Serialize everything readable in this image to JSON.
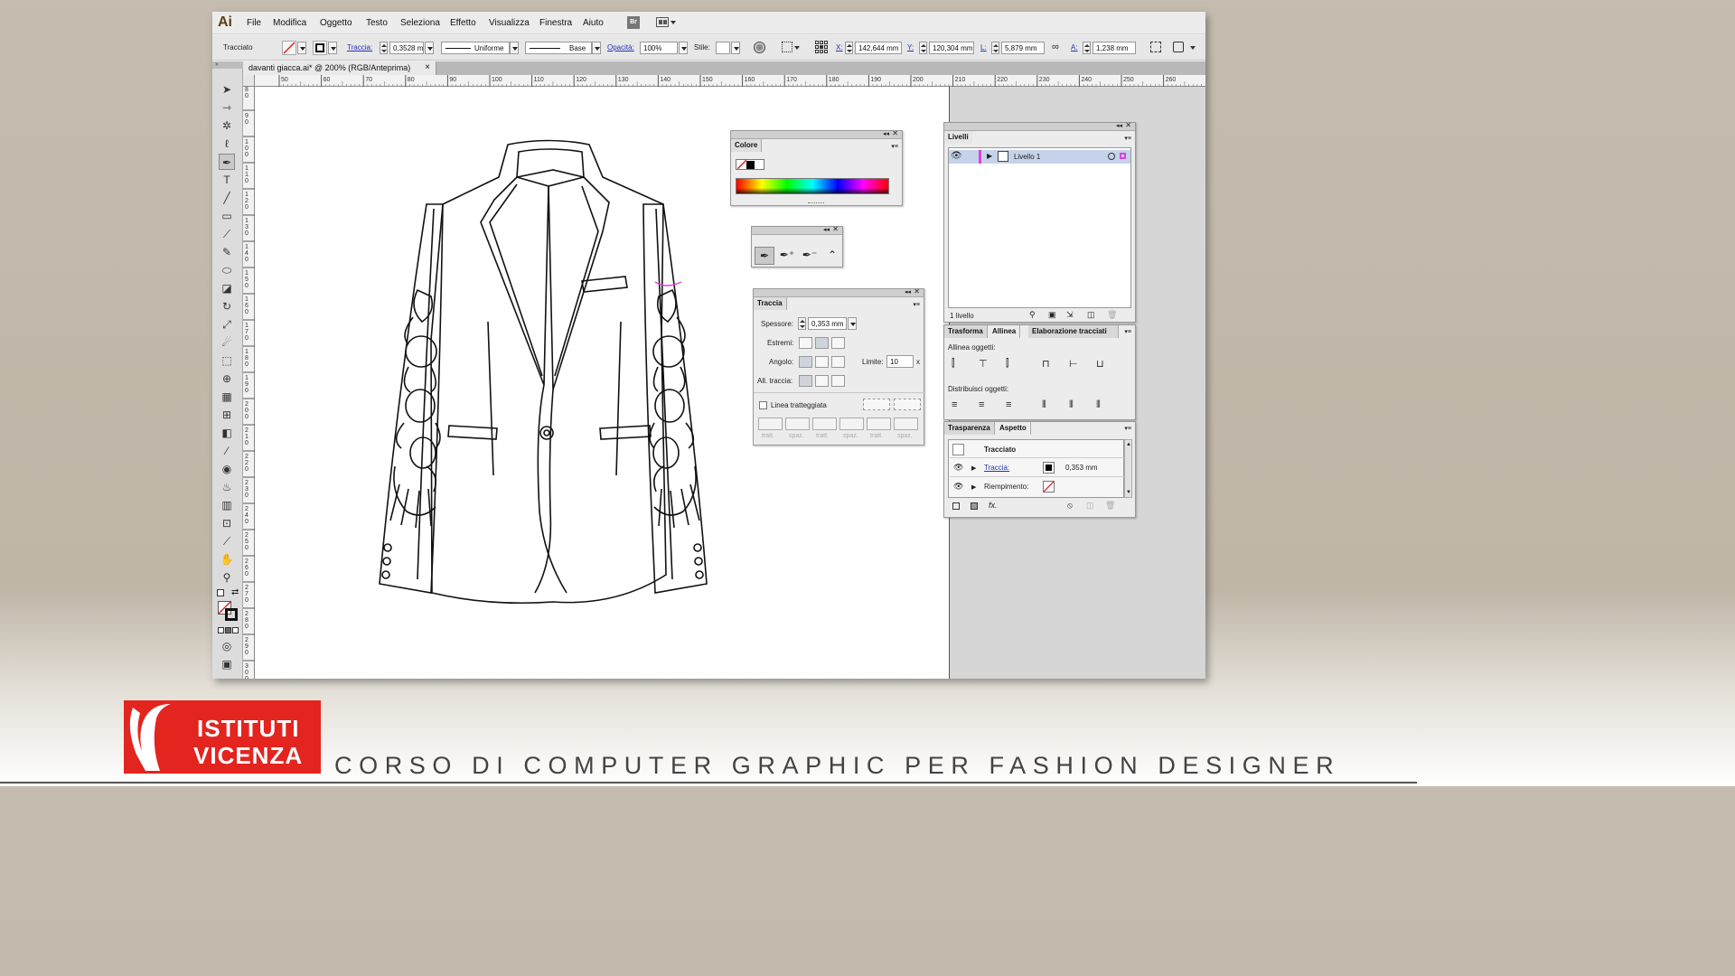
{
  "app": {
    "logo": "Ai"
  },
  "menu": [
    "File",
    "Modifica",
    "Oggetto",
    "Testo",
    "Seleziona",
    "Effetto",
    "Visualizza",
    "Finestra",
    "Aiuto"
  ],
  "menu_br": "Br",
  "control_bar": {
    "object_type": "Tracciato",
    "stroke_label": "Traccia:",
    "stroke_value": "0,3528 m",
    "profile_value": "Uniforme",
    "brush_value": "Base",
    "opacity_label": "Opacità:",
    "opacity_value": "100%",
    "style_label": "Stile:",
    "x_label": "X:",
    "x_value": "142,644 mm",
    "y_label": "Y:",
    "y_value": "120,304 mm",
    "w_label": "L:",
    "w_value": "5,879 mm",
    "h_label": "A:",
    "h_value": "1,238 mm"
  },
  "document_tab": {
    "title": "davanti giacca.ai* @ 200% (RGB/Anteprima)",
    "close": "×"
  },
  "rulers": {
    "h_ticks": [
      "50",
      "60",
      "70",
      "80",
      "90",
      "100",
      "110",
      "120",
      "130",
      "140",
      "150",
      "160",
      "170",
      "180",
      "190",
      "200",
      "210",
      "220",
      "230",
      "240",
      "250",
      "260"
    ],
    "v_ticks": [
      "80",
      "90",
      "100",
      "110",
      "120",
      "130",
      "140",
      "150",
      "160",
      "170",
      "180",
      "190",
      "200",
      "210",
      "220",
      "230",
      "240",
      "250",
      "260",
      "270",
      "280",
      "290",
      "300"
    ]
  },
  "colore_panel": {
    "title": "Colore"
  },
  "traccia_panel": {
    "title": "Traccia",
    "weight_label": "Spessore:",
    "weight_value": "0,353 mm",
    "cap_label": "Estremi:",
    "corner_label": "Angolo:",
    "limit_label": "Limite:",
    "limit_value": "10",
    "limit_unit": "x",
    "align_label": "All. traccia:",
    "dashed_label": "Linea tratteggiata",
    "dash_fields": [
      "tratt.",
      "spaz.",
      "tratt.",
      "spaz.",
      "tratt.",
      "spaz."
    ]
  },
  "livelli_panel": {
    "title": "Livelli",
    "layer_name": "Livello 1",
    "footer": "1 livello"
  },
  "allinea_panel": {
    "tabs": [
      "Trasforma",
      "Allinea",
      "Elaborazione tracciati"
    ],
    "align_objects": "Allinea oggetti:",
    "distribute_objects": "Distribuisci oggetti:"
  },
  "aspetto_panel": {
    "tabs": [
      "Trasparenza",
      "Aspetto"
    ],
    "object_title": "Tracciato",
    "stroke_label": "Traccia:",
    "stroke_value": "0,353 mm",
    "fill_label": "Riempimento:",
    "fx": "fx."
  },
  "footer": {
    "logo_line1": "ISTITUTI",
    "logo_line2": "VICENZA",
    "course_title": "CORSO DI COMPUTER GRAPHIC PER FASHION DESIGNER"
  },
  "colors": {
    "accent_link": "#2233bb",
    "logo_red": "#e4241f",
    "layer_selected": "#c5d3ea"
  }
}
